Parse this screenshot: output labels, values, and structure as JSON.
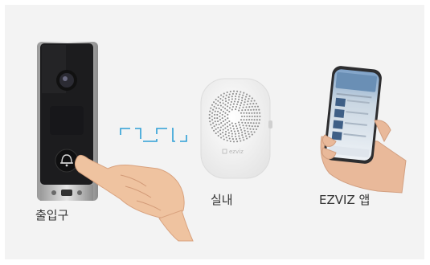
{
  "labels": {
    "doorbell": "출입구",
    "chime": "실내",
    "app": "EZVIZ 앱"
  },
  "chime_brand": "ezviz",
  "colors": {
    "background": "#f3f3f3",
    "signal": "#2e9fd6",
    "doorbell_body": "#1c1c1e",
    "chime_body": "#f7f7f7"
  },
  "icons": [
    "bell-icon",
    "signal-wave-icon",
    "hand-icon",
    "phone-icon"
  ]
}
